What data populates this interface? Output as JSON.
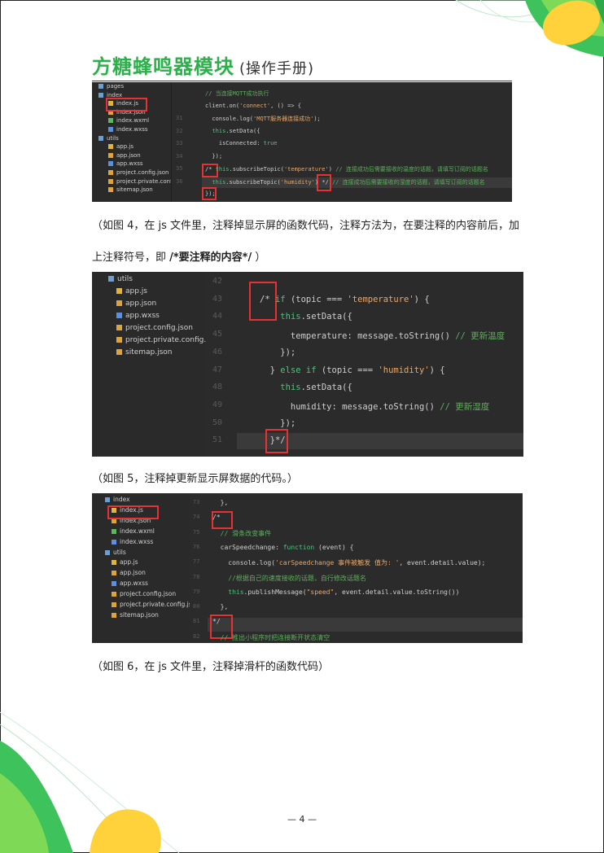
{
  "header": {
    "title": "方糖蜂鸣器模块",
    "subtitle": "(操作手册)"
  },
  "shot1": {
    "tree": [
      {
        "label": "pages",
        "icon": "folder-icon"
      },
      {
        "label": "index",
        "icon": "folder-icon"
      },
      {
        "label": "index.js",
        "icon": "js-file-icon"
      },
      {
        "label": "index.json",
        "icon": "json-file-icon"
      },
      {
        "label": "index.wxml",
        "icon": "wxml-file-icon"
      },
      {
        "label": "index.wxss",
        "icon": "wxss-file-icon"
      },
      {
        "label": "utils",
        "icon": "folder-icon"
      },
      {
        "label": "app.js",
        "icon": "js-file-icon"
      },
      {
        "label": "app.json",
        "icon": "json-file-icon"
      },
      {
        "label": "app.wxss",
        "icon": "wxss-file-icon"
      },
      {
        "label": "project.config.json",
        "icon": "json-file-icon"
      },
      {
        "label": "project.private.config.js...",
        "icon": "json-file-icon"
      },
      {
        "label": "sitemap.json",
        "icon": "json-file-icon"
      }
    ],
    "lines": [
      {
        "n": "",
        "t": "// 当连接MQTT成功执行"
      },
      {
        "n": "",
        "t": "client.on('connect', () => {"
      },
      {
        "n": "31",
        "t": "  console.log('MQTT服务器连接成功');"
      },
      {
        "n": "32",
        "t": "  this.setData({"
      },
      {
        "n": "33",
        "t": "    isConnected: true"
      },
      {
        "n": "34",
        "t": "  });"
      },
      {
        "n": "35",
        "t": "/* this.subscribeTopic('temperature') // 连接成功后需要接收的温度的话题，请填写订阅的话题名"
      },
      {
        "n": "36",
        "t": "  this.subscribeTopic('humidity') */ // 连接成功后需要接收的湿度的话题，请填写订阅的话题名"
      },
      {
        "n": "",
        "t": "});"
      }
    ]
  },
  "para1": {
    "line1": "（如图 4，在 js 文件里，注释掉显示屏的函数代码，注释方法为，在要注释的内容前后，加",
    "line2_a": "上注释符号，即 ",
    "line2_b": "/*要注释的内容*/",
    "line2_c": " ）"
  },
  "shot2": {
    "tree": [
      {
        "label": "utils",
        "icon": "folder-icon"
      },
      {
        "label": "app.js",
        "icon": "js-file-icon"
      },
      {
        "label": "app.json",
        "icon": "json-file-icon"
      },
      {
        "label": "app.wxss",
        "icon": "wxss-file-icon"
      },
      {
        "label": "project.config.json",
        "icon": "json-file-icon"
      },
      {
        "label": "project.private.config.js...",
        "icon": "json-file-icon"
      },
      {
        "label": "sitemap.json",
        "icon": "json-file-icon"
      }
    ],
    "lines": [
      {
        "n": "42",
        "t": ""
      },
      {
        "n": "43",
        "t": "/* if (topic === 'temperature') {"
      },
      {
        "n": "44",
        "t": "    this.setData({"
      },
      {
        "n": "45",
        "t": "      temperature: message.toString() // 更新温度"
      },
      {
        "n": "46",
        "t": "    });"
      },
      {
        "n": "47",
        "t": "  } else if (topic === 'humidity') {"
      },
      {
        "n": "48",
        "t": "    this.setData({"
      },
      {
        "n": "49",
        "t": "      humidity: message.toString() // 更新湿度"
      },
      {
        "n": "50",
        "t": "    });"
      },
      {
        "n": "51",
        "t": "  }*/"
      }
    ]
  },
  "para2": "（如图 5，注释掉更新显示屏数据的代码。）",
  "shot3": {
    "tree": [
      {
        "label": "index",
        "icon": "folder-icon"
      },
      {
        "label": "index.js",
        "icon": "js-file-icon"
      },
      {
        "label": "index.json",
        "icon": "json-file-icon"
      },
      {
        "label": "index.wxml",
        "icon": "wxml-file-icon"
      },
      {
        "label": "index.wxss",
        "icon": "wxss-file-icon"
      },
      {
        "label": "utils",
        "icon": "folder-icon"
      },
      {
        "label": "app.js",
        "icon": "js-file-icon"
      },
      {
        "label": "app.json",
        "icon": "json-file-icon"
      },
      {
        "label": "app.wxss",
        "icon": "wxss-file-icon"
      },
      {
        "label": "project.config.json",
        "icon": "json-file-icon"
      },
      {
        "label": "project.private.config.js...",
        "icon": "json-file-icon"
      },
      {
        "label": "sitemap.json",
        "icon": "json-file-icon"
      }
    ],
    "lines": [
      {
        "n": "73",
        "t": "  },"
      },
      {
        "n": "74",
        "t": "/*"
      },
      {
        "n": "75",
        "t": "  // 滑条改变事件"
      },
      {
        "n": "76",
        "t": "  carSpeedchange: function (event) {"
      },
      {
        "n": "77",
        "t": "    console.log('carSpeedchange 事件被触发 值为: ', event.detail.value);"
      },
      {
        "n": "78",
        "t": "    //根据自己的速度接收的话题，自行修改话题名"
      },
      {
        "n": "79",
        "t": "    this.publishMessage(\"speed\", event.detail.value.toString())"
      },
      {
        "n": "80",
        "t": "  },"
      },
      {
        "n": "81",
        "t": "*/"
      },
      {
        "n": "82",
        "t": "  // 推出小程序时把连接断开状态清空"
      }
    ]
  },
  "para3": "（如图 6，在 js 文件里，注释掉滑杆的函数代码）",
  "footer": {
    "page": "— 4 —"
  },
  "colors": {
    "title_green": "#2bb04a",
    "highlight_red": "#e53333",
    "editor_bg": "#2b2b2b"
  }
}
